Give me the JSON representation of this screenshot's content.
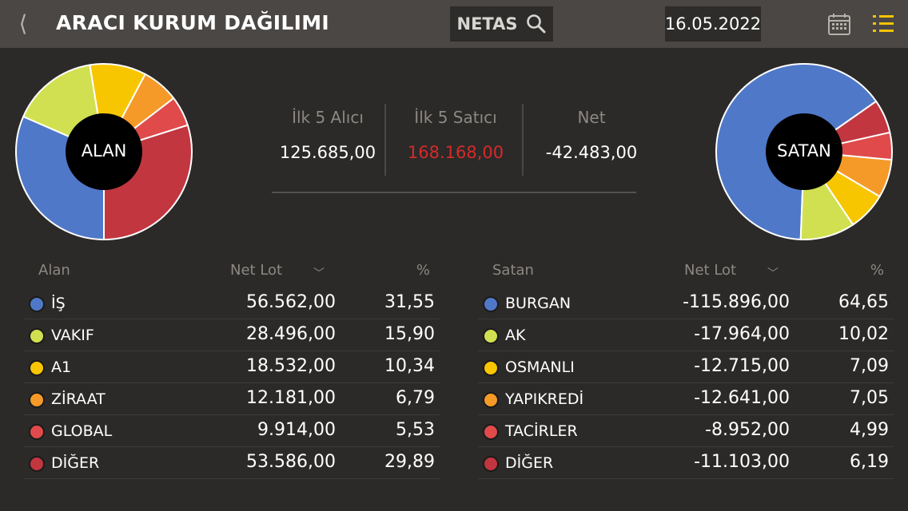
{
  "header": {
    "back_icon": "chevron-left-icon",
    "title": "ARACI KURUM DAĞILIMI",
    "symbol": "NETAS",
    "search_icon": "search-icon",
    "date": "16.05.2022",
    "calendar_icon": "calendar-icon",
    "menu_icon": "list-icon",
    "accent_color": "#f5c400"
  },
  "pies": {
    "buy_label": "ALAN",
    "sell_label": "SATAN"
  },
  "summary": {
    "top_buyers_label": "İlk 5 Alıcı",
    "top_buyers_value": "125.685,00",
    "top_sellers_label": "İlk 5 Satıcı",
    "top_sellers_value": "168.168,00",
    "net_label": "Net",
    "net_value": "-42.483,00",
    "sellers_color": "#d42a2a"
  },
  "buy_table": {
    "col_name": "Alan",
    "col_lot": "Net Lot",
    "col_pct": "%",
    "sort_icon": "chevron-down-icon",
    "rows": [
      {
        "name": "İŞ",
        "lot": "56.562,00",
        "pct": "31,55",
        "pct_value": 31.55,
        "color": "#4f78c8"
      },
      {
        "name": "VAKIF",
        "lot": "28.496,00",
        "pct": "15,90",
        "pct_value": 15.9,
        "color": "#d1e050"
      },
      {
        "name": "A1",
        "lot": "18.532,00",
        "pct": "10,34",
        "pct_value": 10.34,
        "color": "#f7c600"
      },
      {
        "name": "ZİRAAT",
        "lot": "12.181,00",
        "pct": "6,79",
        "pct_value": 6.79,
        "color": "#f59a28"
      },
      {
        "name": "GLOBAL",
        "lot": "9.914,00",
        "pct": "5,53",
        "pct_value": 5.53,
        "color": "#e04a4a"
      },
      {
        "name": "DİĞER",
        "lot": "53.586,00",
        "pct": "29,89",
        "pct_value": 29.89,
        "color": "#c23640"
      }
    ]
  },
  "sell_table": {
    "col_name": "Satan",
    "col_lot": "Net Lot",
    "col_pct": "%",
    "sort_icon": "chevron-down-icon",
    "rows": [
      {
        "name": "BURGAN",
        "lot": "-115.896,00",
        "pct": "64,65",
        "pct_value": 64.65,
        "color": "#4f78c8"
      },
      {
        "name": "AK",
        "lot": "-17.964,00",
        "pct": "10,02",
        "pct_value": 10.02,
        "color": "#d1e050"
      },
      {
        "name": "OSMANLI",
        "lot": "-12.715,00",
        "pct": "7,09",
        "pct_value": 7.09,
        "color": "#f7c600"
      },
      {
        "name": "YAPIKREDİ",
        "lot": "-12.641,00",
        "pct": "7,05",
        "pct_value": 7.05,
        "color": "#f59a28"
      },
      {
        "name": "TACİRLER",
        "lot": "-8.952,00",
        "pct": "4,99",
        "pct_value": 4.99,
        "color": "#e04a4a"
      },
      {
        "name": "DİĞER",
        "lot": "-11.103,00",
        "pct": "6,19",
        "pct_value": 6.19,
        "color": "#c23640"
      }
    ]
  }
}
